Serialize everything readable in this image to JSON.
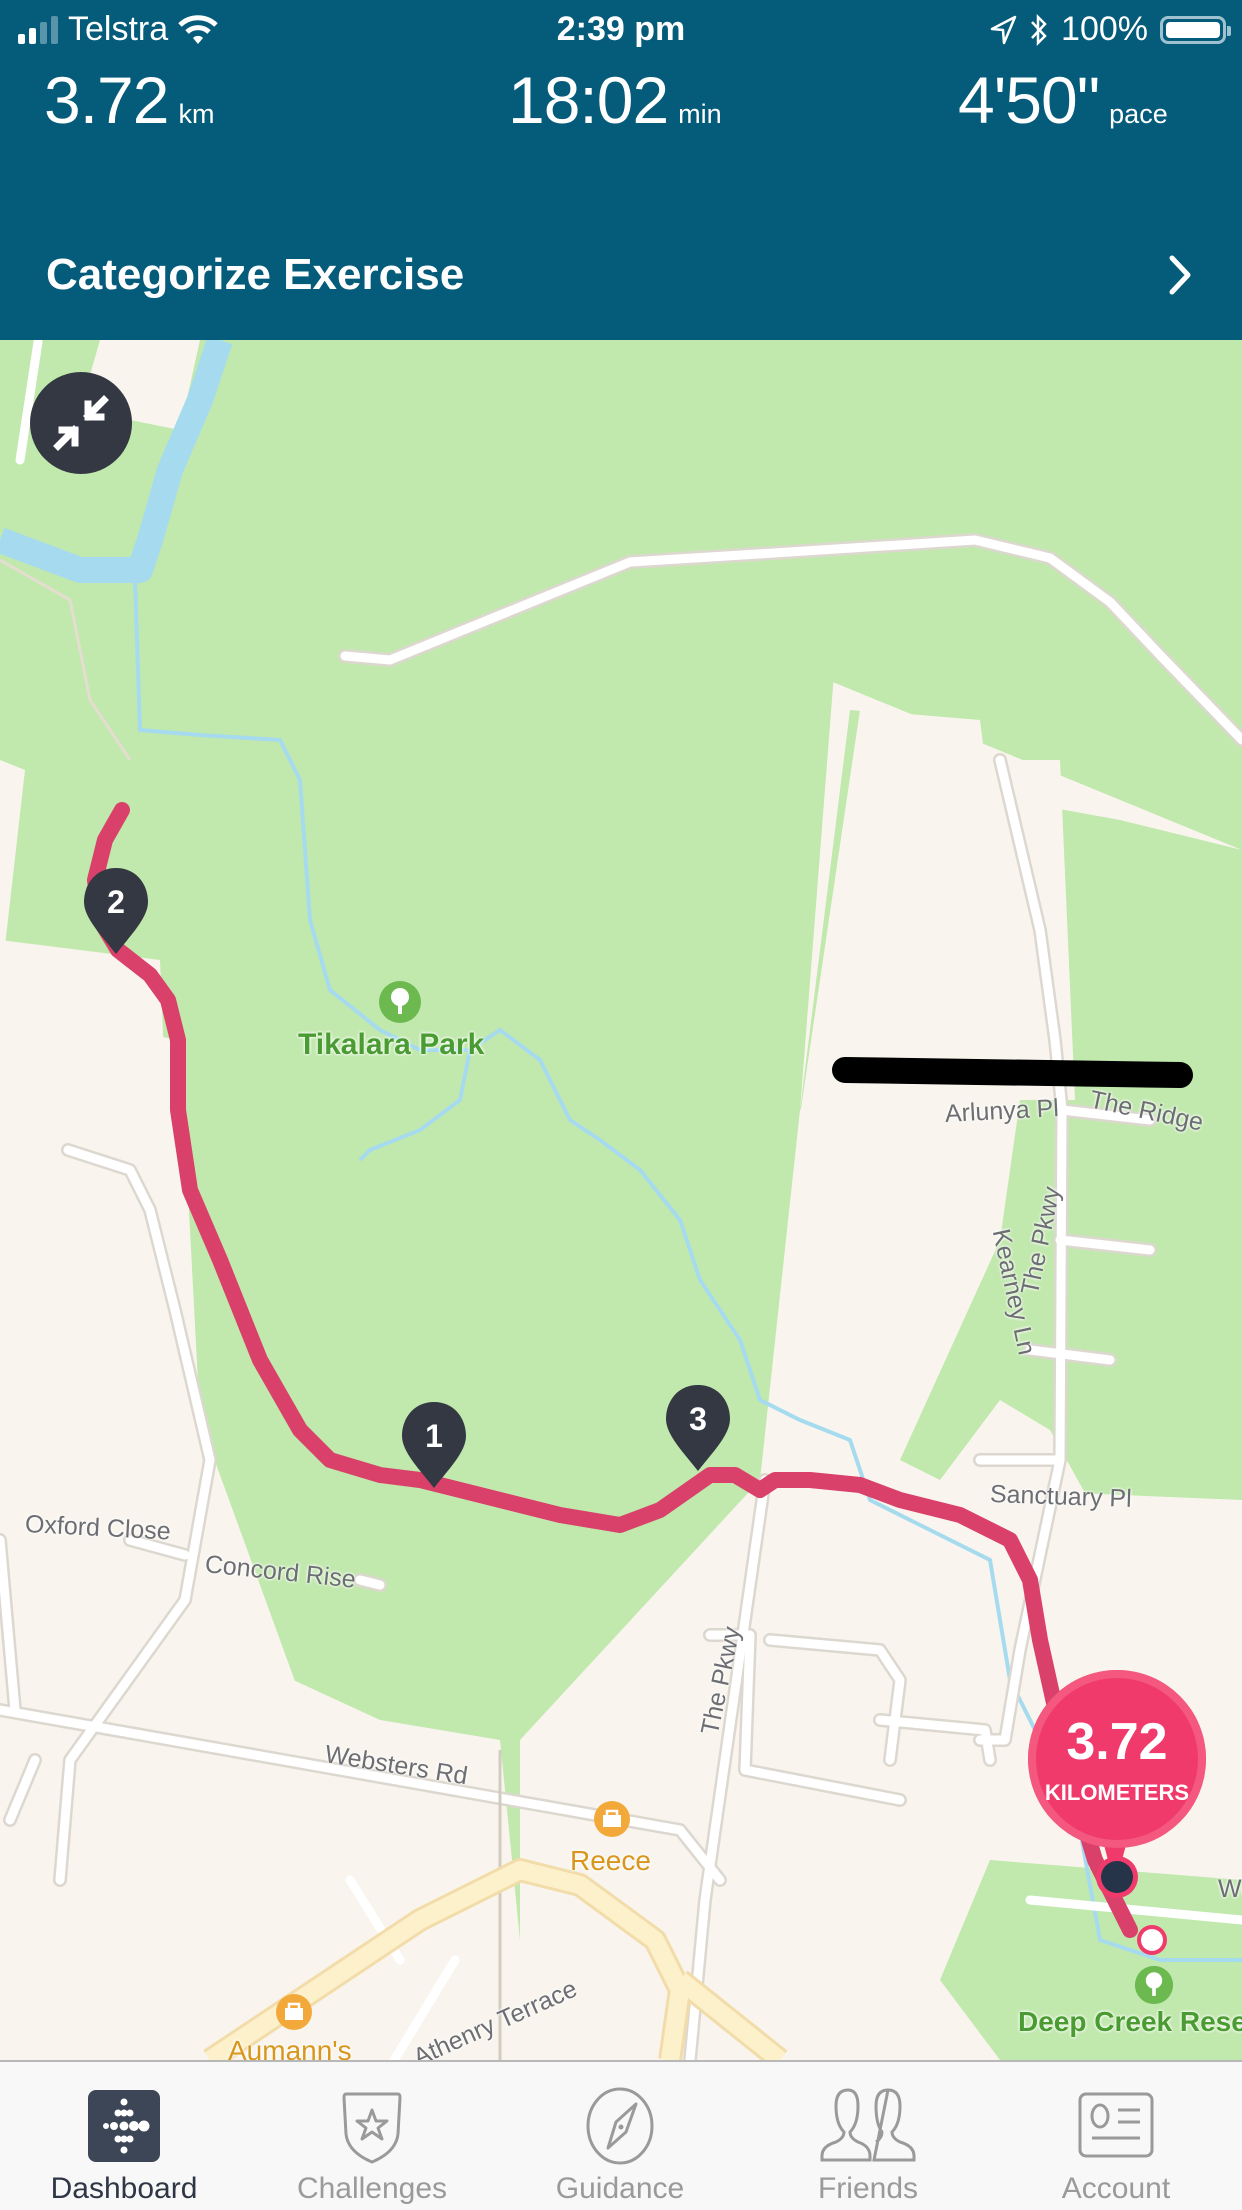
{
  "status_bar": {
    "carrier": "Telstra",
    "time": "2:39 pm",
    "battery": "100%",
    "icons": [
      "signal-icon",
      "wifi-icon",
      "location-arrow-icon",
      "bluetooth-icon",
      "battery-icon"
    ]
  },
  "summary": {
    "distance": {
      "value": "3.72",
      "unit": "km"
    },
    "duration": {
      "value": "18:02",
      "unit": "min"
    },
    "pace": {
      "value": "4'50\"",
      "unit": "pace"
    }
  },
  "categorize": {
    "label": "Categorize Exercise",
    "icon": "chevron-right-icon"
  },
  "map": {
    "collapse_icon": "collapse-arrows-icon",
    "route_color": "#d9416a",
    "split_markers": [
      "1",
      "2",
      "3"
    ],
    "distance_badge": {
      "value": "3.72",
      "label": "KILOMETERS"
    },
    "street_labels": {
      "kearney_ln": "Kearney Ln",
      "arlunya_pl": "Arlunya Pl",
      "the_ridge": "The Ridge",
      "the_pkwy_north": "The Pkwy",
      "sanctuary_pl": "Sanctuary Pl",
      "oxford_close": "Oxford Close",
      "concord_rise": "Concord Rise",
      "websters_rd": "Websters Rd",
      "the_pkwy_south": "The Pkwy",
      "athenry_terrace": "Athenry Terrace",
      "we_partial": "We"
    },
    "parks": {
      "tikalara": "Tikalara Park",
      "deep_creek": "Deep Creek Rese"
    },
    "pois": {
      "reece": "Reece",
      "aumanns": "Aumann's"
    }
  },
  "tabbar": {
    "tabs": [
      {
        "label": "Dashboard",
        "icon": "fitbit-dots-icon",
        "active": true
      },
      {
        "label": "Challenges",
        "icon": "star-badge-icon",
        "active": false
      },
      {
        "label": "Guidance",
        "icon": "compass-icon",
        "active": false
      },
      {
        "label": "Friends",
        "icon": "friends-icon",
        "active": false
      },
      {
        "label": "Account",
        "icon": "account-card-icon",
        "active": false
      }
    ]
  },
  "colors": {
    "header_bg": "#055b7a",
    "park_green": "#c1e8ad",
    "land": "#f9f5ee",
    "water": "#a6dbef",
    "route": "#d9416a",
    "badge": "#f03a6c",
    "marker": "#333843"
  }
}
